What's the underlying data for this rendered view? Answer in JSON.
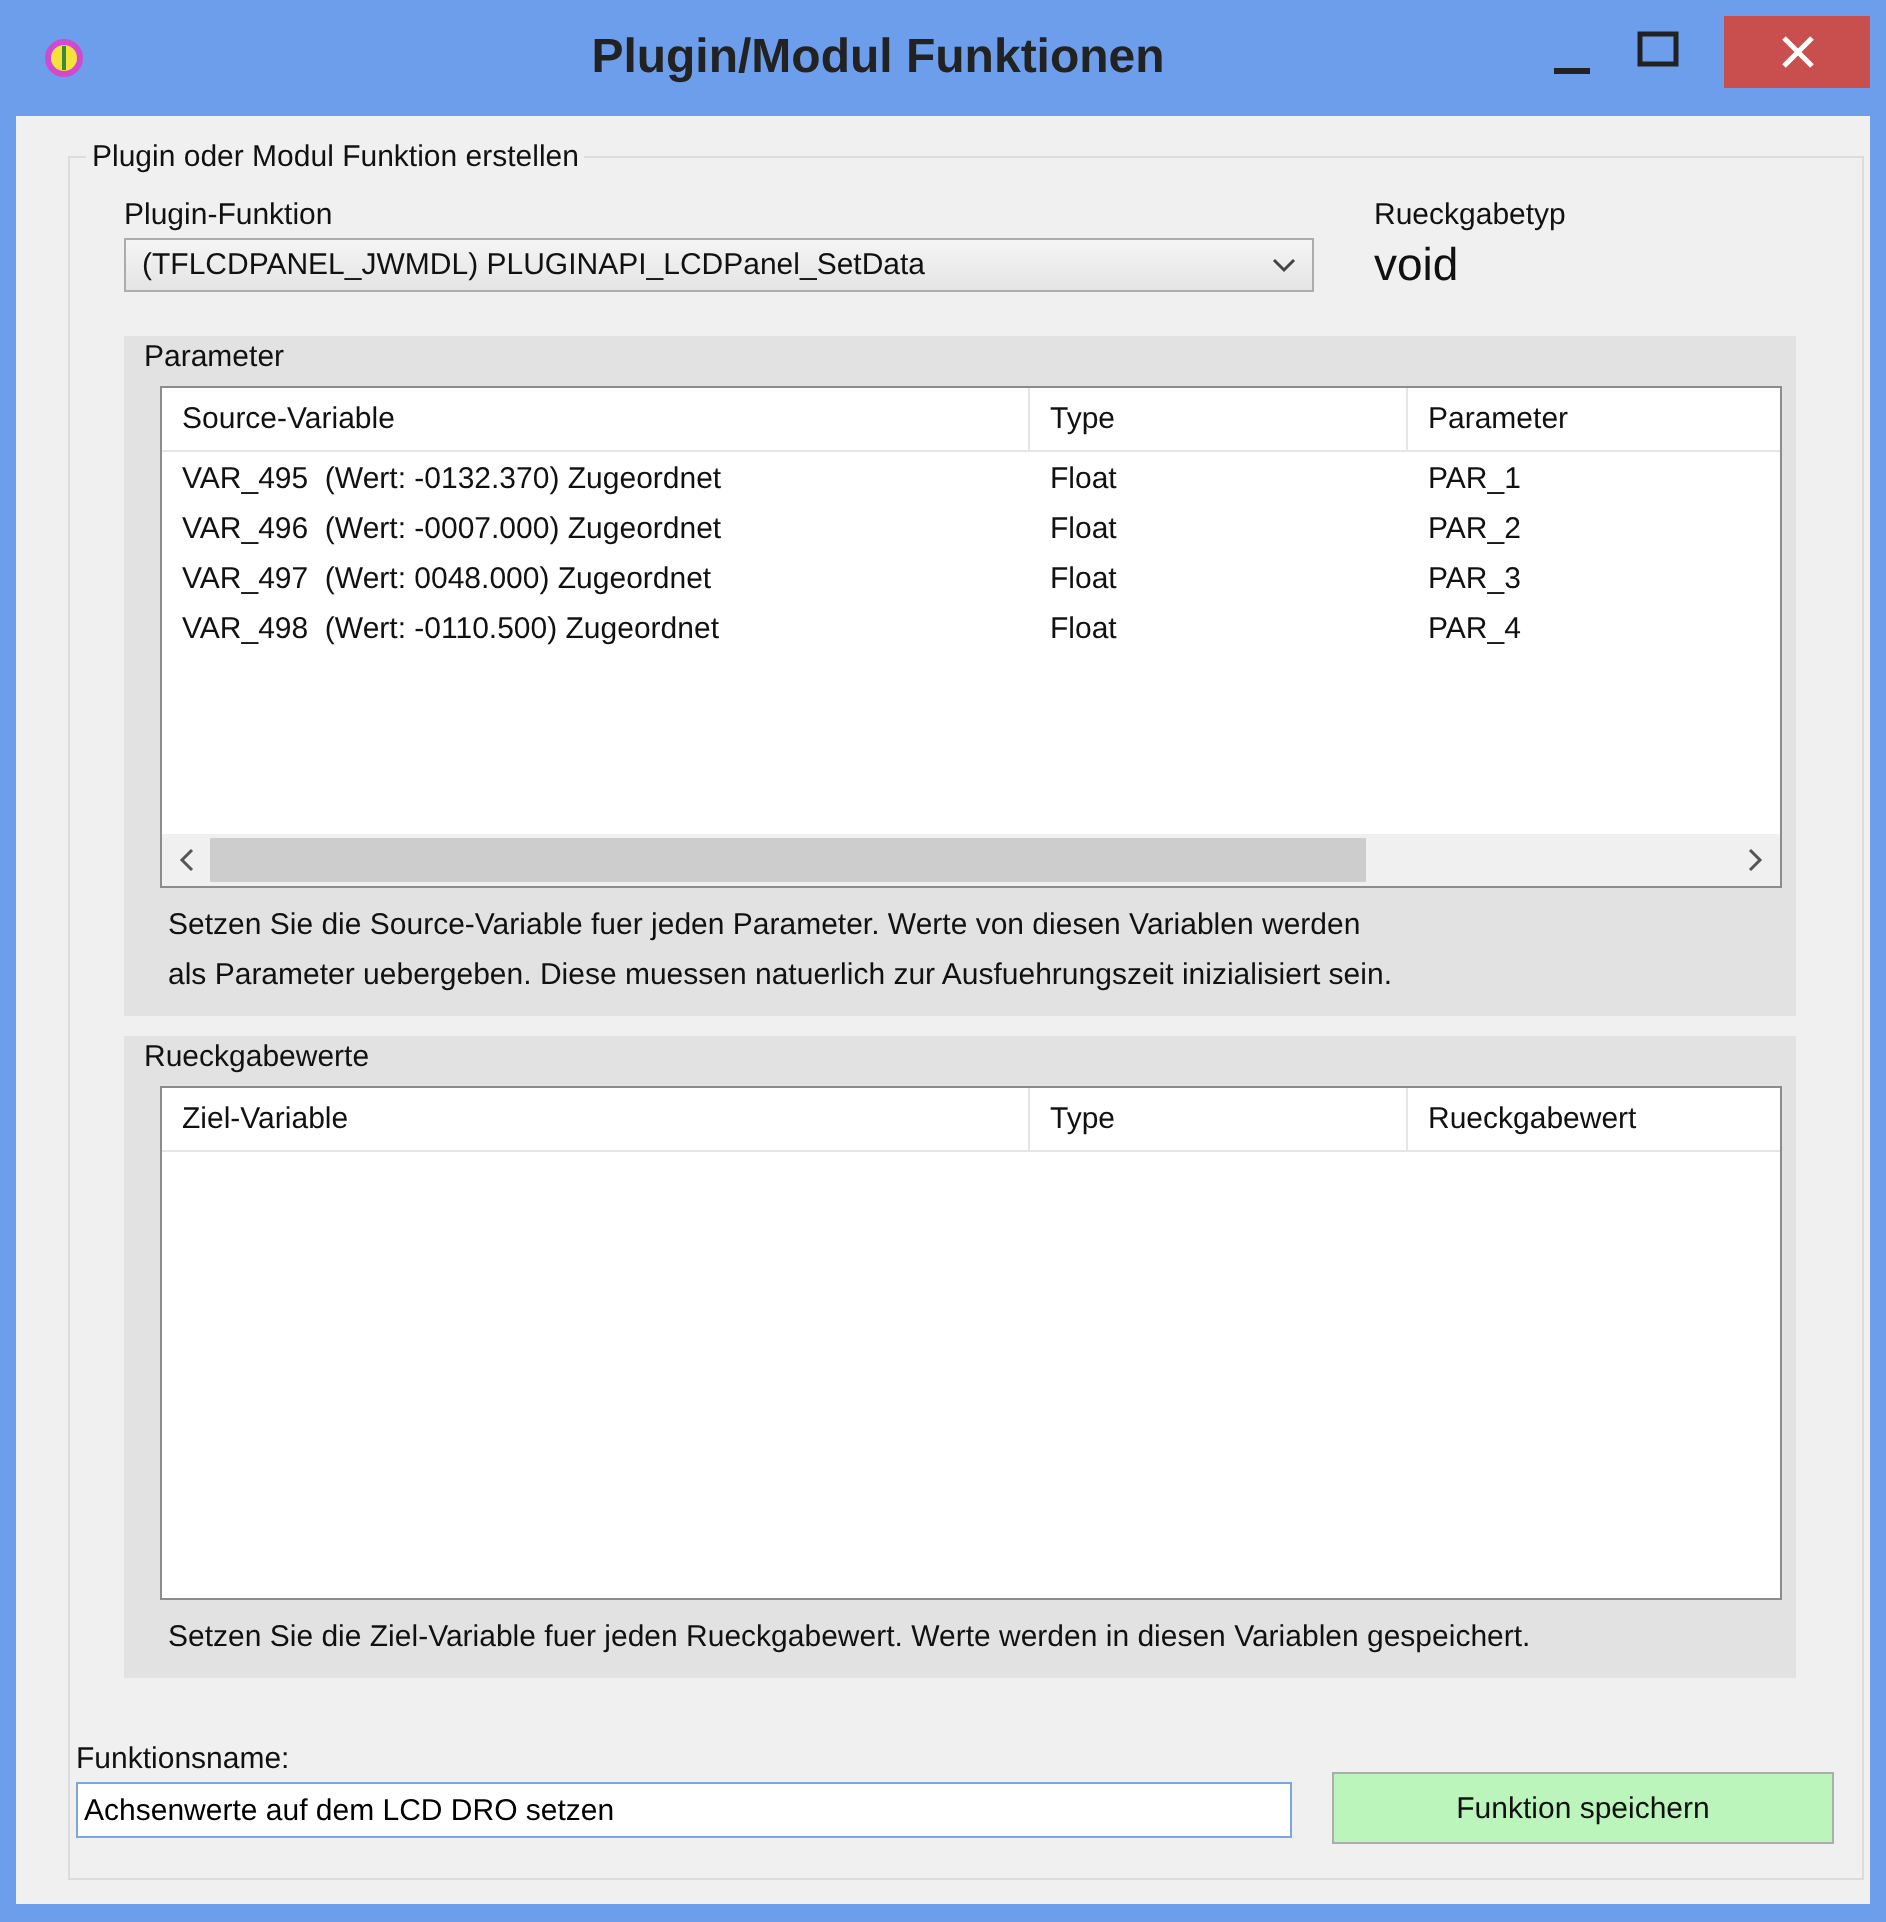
{
  "window": {
    "title": "Plugin/Modul Funktionen"
  },
  "group": {
    "title": "Plugin oder Modul Funktion erstellen"
  },
  "plugin_function": {
    "label": "Plugin-Funktion",
    "value": "(TFLCDPANEL_JWMDL) PLUGINAPI_LCDPanel_SetData"
  },
  "return_type": {
    "label": "Rueckgabetyp",
    "value": "void"
  },
  "parameters": {
    "title": "Parameter",
    "columns": [
      "Source-Variable",
      "Type",
      "Parameter"
    ],
    "rows": [
      [
        "VAR_495  (Wert: -0132.370) Zugeordnet",
        "Float",
        "PAR_1"
      ],
      [
        "VAR_496  (Wert: -0007.000) Zugeordnet",
        "Float",
        "PAR_2"
      ],
      [
        "VAR_497  (Wert: 0048.000) Zugeordnet",
        "Float",
        "PAR_3"
      ],
      [
        "VAR_498  (Wert: -0110.500) Zugeordnet",
        "Float",
        "PAR_4"
      ]
    ],
    "hint_lines": [
      "Setzen Sie die Source-Variable fuer jeden Parameter. Werte von diesen Variablen werden",
      "als Parameter uebergeben. Diese muessen natuerlich zur Ausfuehrungszeit inizialisiert sein."
    ]
  },
  "return_values": {
    "title": "Rueckgabewerte",
    "columns": [
      "Ziel-Variable",
      "Type",
      "Rueckgabewert"
    ],
    "hint_lines": [
      "Setzen Sie die Ziel-Variable fuer jeden Rueckgabewert. Werte werden in diesen Variablen gespeichert."
    ]
  },
  "function_name": {
    "label": "Funktionsname:",
    "value": "Achsenwerte auf dem LCD DRO setzen"
  },
  "save_button": {
    "label": "Funktion speichern"
  }
}
